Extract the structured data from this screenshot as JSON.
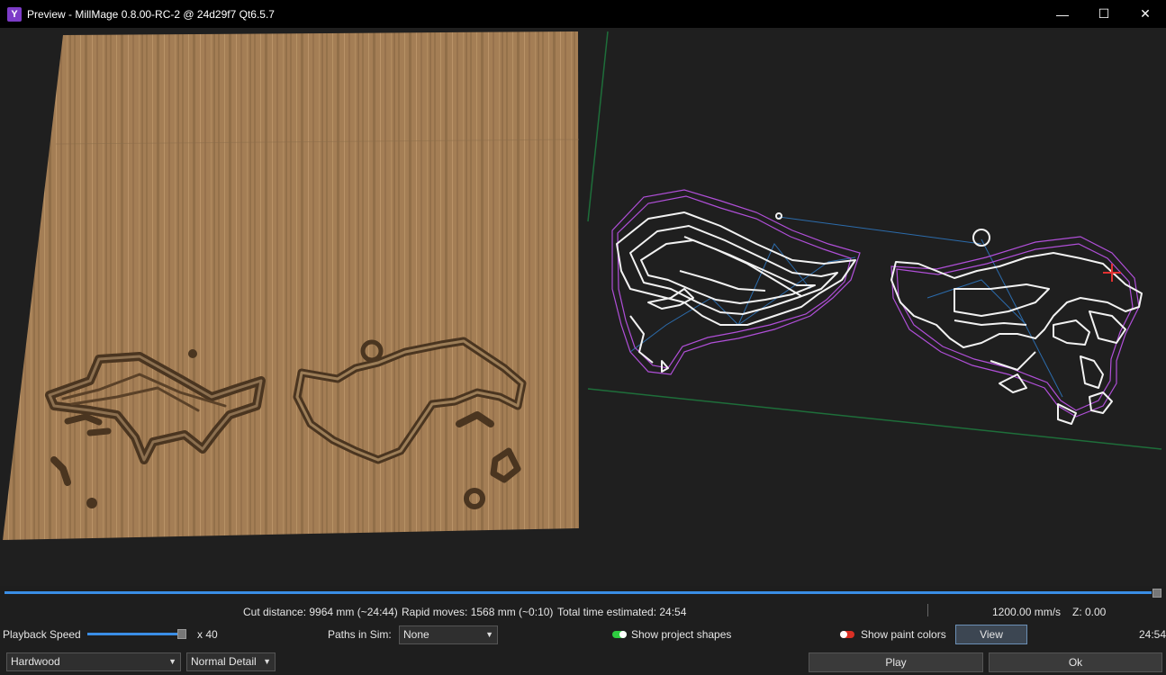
{
  "window": {
    "title": "Preview - MillMage 0.8.00-RC-2 @ 24d29f7 Qt6.5.7",
    "app_icon_glyph": "Y",
    "minimize": "—",
    "maximize": "☐",
    "close": "✕"
  },
  "stats": {
    "cut_distance": "Cut distance: 9964 mm (~24:44)",
    "rapid_moves": "Rapid moves: 1568 mm (~0:10)",
    "total_time": "Total time estimated: 24:54",
    "speed": "1200.00 mm/s",
    "z": "Z: 0.00"
  },
  "playback": {
    "label": "Playback Speed",
    "multiplier": "x 40",
    "time": "24:54",
    "progress": 1.0
  },
  "paths_in_sim": {
    "label": "Paths in Sim:",
    "value": "None"
  },
  "show_project_shapes": {
    "label": "Show project shapes",
    "on": true
  },
  "show_paint_colors": {
    "label": "Show paint colors",
    "on": false
  },
  "buttons": {
    "view": "View",
    "play": "Play",
    "ok": "Ok"
  },
  "material": {
    "value": "Hardwood"
  },
  "detail": {
    "value": "Normal Detail"
  },
  "colors": {
    "accent": "#3a8ee6",
    "toggle_on": "#2ecc40",
    "toggle_off": "#d93025"
  },
  "icons": {
    "app": "millmage-icon",
    "combo_arrow": "chevron-down-icon",
    "origin": "crosshair-icon"
  }
}
